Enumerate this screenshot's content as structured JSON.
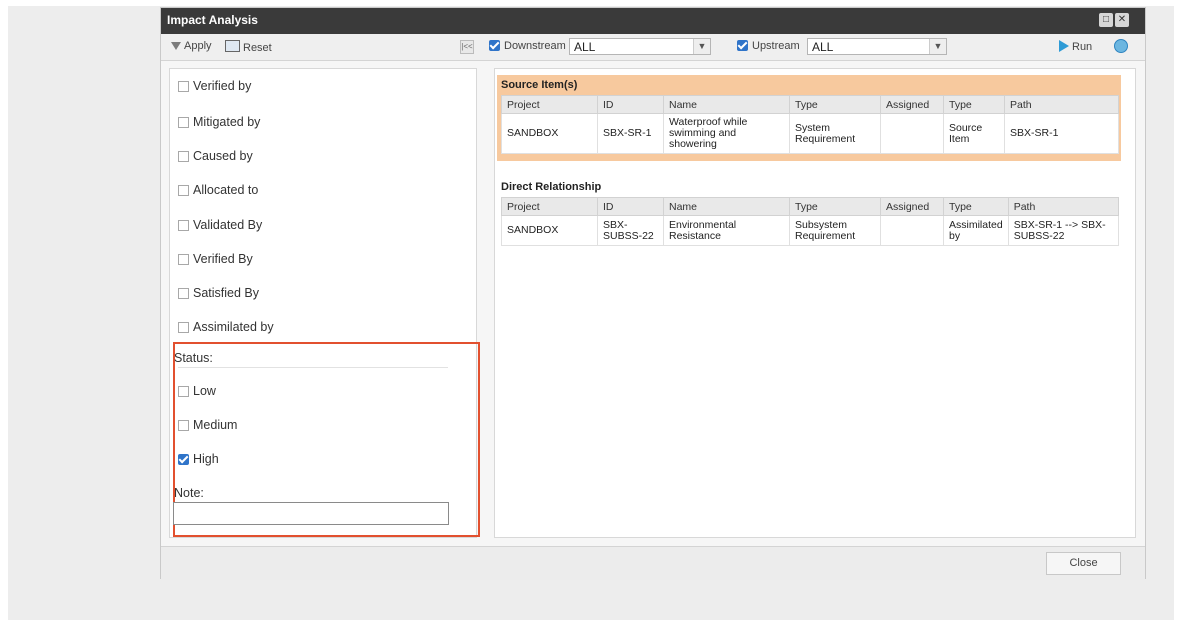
{
  "window": {
    "title": "Impact Analysis"
  },
  "toolbar": {
    "apply_label": "Apply",
    "reset_label": "Reset",
    "collapse_label": "|<<",
    "downstream_label": "Downstream",
    "downstream_value": "ALL",
    "upstream_label": "Upstream",
    "upstream_value": "ALL",
    "run_label": "Run"
  },
  "relationships": [
    {
      "label": "Verified by",
      "checked": false
    },
    {
      "label": "Mitigated by",
      "checked": false
    },
    {
      "label": "Caused by",
      "checked": false
    },
    {
      "label": "Allocated to",
      "checked": false
    },
    {
      "label": "Validated By",
      "checked": false
    },
    {
      "label": "Verified By",
      "checked": false
    },
    {
      "label": "Satisfied By",
      "checked": false
    },
    {
      "label": "Assimilated by",
      "checked": false
    }
  ],
  "status": {
    "label": "Status:",
    "options": [
      {
        "label": "Low",
        "checked": false
      },
      {
        "label": "Medium",
        "checked": false
      },
      {
        "label": "High",
        "checked": true
      }
    ]
  },
  "note": {
    "label": "Note:",
    "value": ""
  },
  "source_items": {
    "title": "Source Item(s)",
    "columns": [
      "Project",
      "ID",
      "Name",
      "Type",
      "Assigned",
      "Type",
      "Path"
    ],
    "rows": [
      [
        "SANDBOX",
        "SBX-SR-1",
        "Waterproof while swimming and showering",
        "System Requirement",
        "",
        "Source Item",
        "SBX-SR-1"
      ]
    ]
  },
  "direct_relationship": {
    "title": "Direct Relationship",
    "columns": [
      "Project",
      "ID",
      "Name",
      "Type",
      "Assigned",
      "Type",
      "Path"
    ],
    "rows": [
      [
        "SANDBOX",
        "SBX-SUBSS-22",
        "Environmental Resistance",
        "Subsystem Requirement",
        "",
        "Assimilated by",
        "SBX-SR-1 --> SBX-SUBSS-22"
      ]
    ]
  },
  "footer": {
    "close_label": "Close"
  },
  "colors": {
    "titlebar": "#3a3a3a",
    "highlight": "#e2502f",
    "source_block": "#f7c99e",
    "link": "#2f74c9"
  }
}
